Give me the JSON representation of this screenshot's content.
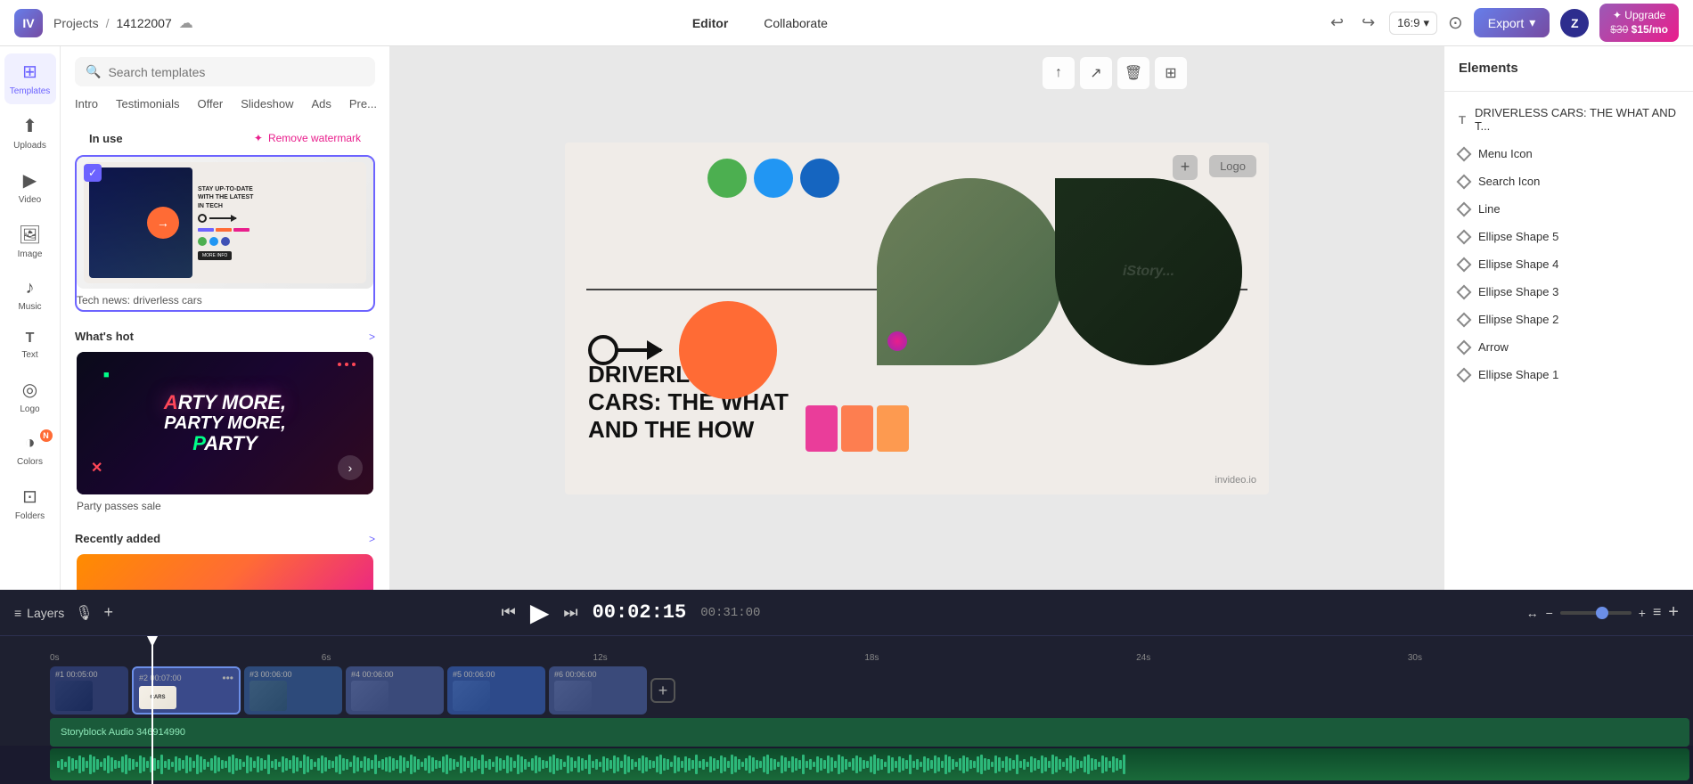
{
  "app": {
    "logo_text": "IV",
    "breadcrumb": {
      "projects_label": "Projects",
      "separator": "/",
      "project_id": "14122007"
    }
  },
  "topbar": {
    "undo_icon": "↩",
    "redo_icon": "↪",
    "aspect_ratio": "16:9",
    "chevron_icon": "▾",
    "settings_icon": "⊙",
    "export_label": "Export",
    "export_chevron": "▾",
    "avatar_letter": "Z",
    "upgrade_label": "✦ Upgrade",
    "price_old": "$30",
    "price_new": "$15/mo",
    "editor_label": "Editor",
    "collaborate_label": "Collaborate"
  },
  "sidebar": {
    "items": [
      {
        "id": "templates",
        "icon": "⊞",
        "label": "Templates",
        "active": true
      },
      {
        "id": "uploads",
        "icon": "↑",
        "label": "Uploads",
        "active": false
      },
      {
        "id": "video",
        "icon": "▶",
        "label": "Video",
        "active": false
      },
      {
        "id": "image",
        "icon": "🖼",
        "label": "Image",
        "active": false
      },
      {
        "id": "music",
        "icon": "♪",
        "label": "Music",
        "active": false
      },
      {
        "id": "text",
        "icon": "T",
        "label": "Text",
        "active": false
      },
      {
        "id": "logo",
        "icon": "◎",
        "label": "Logo",
        "active": false
      },
      {
        "id": "colors",
        "icon": "◑",
        "label": "Colors",
        "active": false
      },
      {
        "id": "folders",
        "icon": "⊡",
        "label": "Folders",
        "active": false
      }
    ],
    "notif_label": "N"
  },
  "templates_panel": {
    "search_placeholder": "Search templates",
    "tabs": [
      "Intro",
      "Testimonials",
      "Offer",
      "Slideshow",
      "Ads",
      "Pre..."
    ],
    "in_use_label": "In use",
    "watermark_label": "Remove watermark",
    "template1": {
      "name": "Tech news: driverless cars",
      "thumb_desc": "tech news thumbnail"
    },
    "whats_hot_label": "What's hot",
    "whats_hot_more": ">",
    "template2": {
      "name": "Party passes sale",
      "thumb_desc": "party thumbnail"
    },
    "recently_added_label": "Recently added",
    "recently_added_more": ">"
  },
  "canvas": {
    "logo_label": "Logo",
    "plus_icon": "+",
    "main_title_line1": "DRIVERLESS",
    "main_title_line2": "CARS: THE WHAT",
    "main_title_line3": "AND THE HOW",
    "invideo_watermark": "invideo.io",
    "stock_label": "iStock"
  },
  "right_panel": {
    "title": "Elements",
    "elements": [
      {
        "id": "title-text",
        "type": "T",
        "label": "DRIVERLESS CARS: THE WHAT AND T..."
      },
      {
        "id": "menu-icon",
        "type": "diamond",
        "label": "Menu Icon"
      },
      {
        "id": "search-icon",
        "type": "diamond",
        "label": "Search Icon"
      },
      {
        "id": "line",
        "type": "diamond",
        "label": "Line"
      },
      {
        "id": "ellipse5",
        "type": "diamond",
        "label": "Ellipse Shape 5"
      },
      {
        "id": "ellipse4",
        "type": "diamond",
        "label": "Ellipse Shape 4"
      },
      {
        "id": "ellipse3",
        "type": "diamond",
        "label": "Ellipse Shape 3"
      },
      {
        "id": "ellipse2",
        "type": "diamond",
        "label": "Ellipse Shape 2"
      },
      {
        "id": "arrow",
        "type": "diamond",
        "label": "Arrow"
      },
      {
        "id": "ellipse1",
        "type": "diamond",
        "label": "Ellipse Shape 1"
      }
    ]
  },
  "canvas_toolbar_top": {
    "upload_icon": "↑",
    "expand_icon": "↗",
    "delete_icon": "🗑",
    "grid_icon": "⊞"
  },
  "timeline": {
    "layers_label": "Layers",
    "mic_icon": "🎙",
    "add_icon": "+",
    "prev_icon": "⏮",
    "play_icon": "▶",
    "next_icon": "⏭",
    "current_time": "00:02:15",
    "total_time": "00:31:00",
    "fit_icon": "↔",
    "zoom_out_icon": "−",
    "zoom_in_icon": "+",
    "lines_icon": "≡",
    "add_scene_icon": "+",
    "scenes": [
      {
        "num": "#1 00:05:00",
        "active": false
      },
      {
        "num": "#2 00:07:00",
        "active": true
      },
      {
        "num": "#3 00:06:00",
        "active": false
      },
      {
        "num": "#4 00:06:00",
        "active": false
      },
      {
        "num": "#5 00:06:00",
        "active": false
      },
      {
        "num": "#6 00:06:00",
        "active": false
      }
    ],
    "audio_label": "Storyblock Audio 346914990",
    "ruler_marks": [
      "0s",
      "6s",
      "12s",
      "18s",
      "24s",
      "30s"
    ]
  }
}
